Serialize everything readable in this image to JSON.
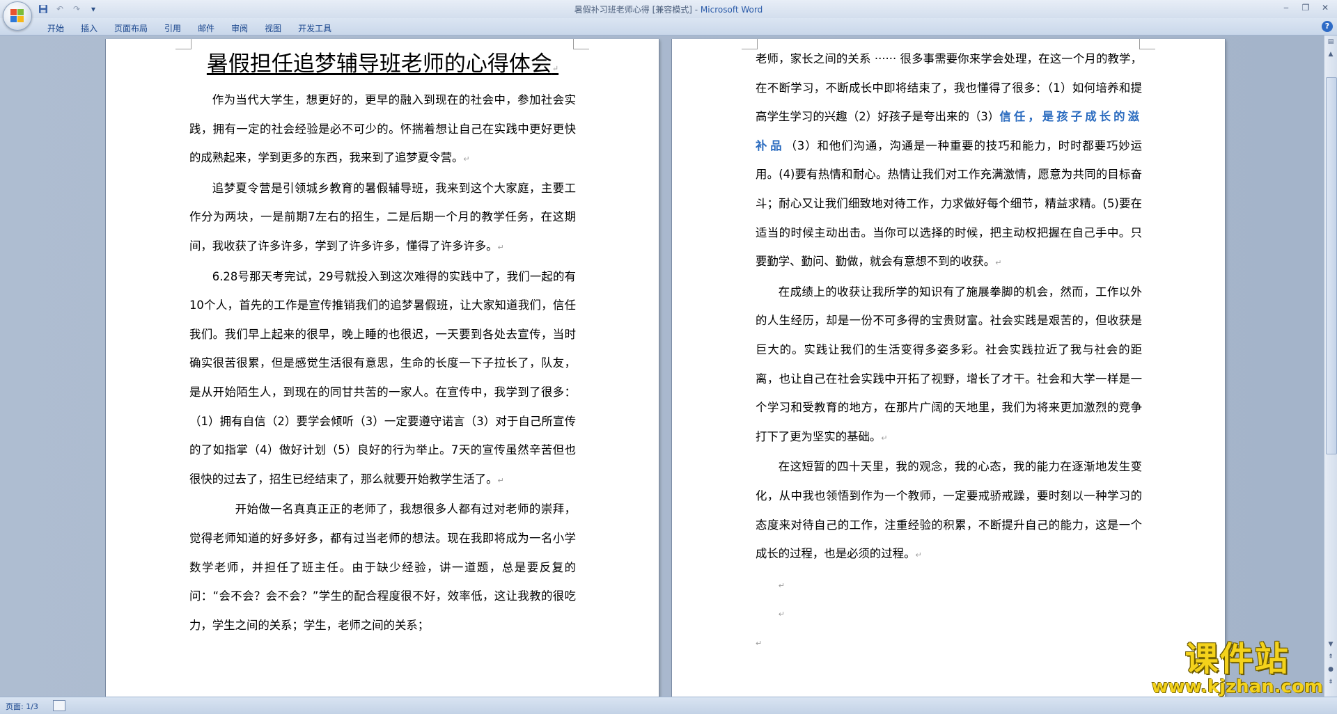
{
  "window": {
    "title_doc": "暑假补习班老师心得 [兼容模式] - ",
    "title_app": "Microsoft Word",
    "minimize": "‒",
    "maximize": "❐",
    "close": "✕"
  },
  "quick_access": {
    "icons": [
      "save-icon",
      "undo-icon",
      "redo-icon",
      "customize-qat-icon"
    ]
  },
  "ribbon": {
    "tabs": [
      "开始",
      "插入",
      "页面布局",
      "引用",
      "邮件",
      "审阅",
      "视图",
      "开发工具"
    ],
    "help": "?"
  },
  "document": {
    "title": "暑假担任追梦辅导班老师的心得体会",
    "left_page": [
      "作为当代大学生，想更好的，更早的融入到现在的社会中，参加社会实践，拥有一定的社会经验是必不可少的。怀揣着想让自己在实践中更好更快的成熟起来，学到更多的东西，我来到了追梦夏令营。",
      "追梦夏令营是引领城乡教育的暑假辅导班，我来到这个大家庭，主要工作分为两块，一是前期7左右的招生，二是后期一个月的教学任务，在这期间，我收获了许多许多，学到了许多许多，懂得了许多许多。",
      "6.28号那天考完试，29号就投入到这次难得的实践中了，我们一起的有10个人，首先的工作是宣传推销我们的追梦暑假班，让大家知道我们，信任我们。我们早上起来的很早，晚上睡的也很迟，一天要到各处去宣传，当时确实很苦很累，但是感觉生活很有意思，生命的长度一下子拉长了，队友，是从开始陌生人，到现在的同甘共苦的一家人。在宣传中，我学到了很多：（1）拥有自信（2）要学会倾听（3）一定要遵守诺言（3）对于自己所宣传的了如指掌（4）做好计划（5）良好的行为举止。7天的宣传虽然辛苦但也很快的过去了，招生已经结束了，那么就要开始教学生活了。",
      "开始做一名真真正正的老师了，我想很多人都有过对老师的崇拜，觉得老师知道的好多好多，都有过当老师的想法。现在我即将成为一名小学数学老师，并担任了班主任。由于缺少经验，讲一道题，总是要反复的问：“会不会？会不会？”学生的配合程度很不好，效率低，这让我教的很吃力，学生之间的关系；学生，老师之间的关系；"
    ],
    "right_page": {
      "p1_a": "老师，家长之间的关系 ······ 很多事需要你来学会处理，在这一个月的教学，在不断学习，不断成长中即将结束了，我也懂得了很多：（1）如何培养和提高学生学习的兴趣（2）好孩子是夸出来的（3）",
      "p1_blue": "信任，是孩子成长的滋补品",
      "p1_b": "（3）和他们沟通，沟通是一种重要的技巧和能力，时时都要巧妙运用。(4)要有热情和耐心。热情让我们对工作充满激情，愿意为共同的目标奋斗；耐心又让我们细致地对待工作，力求做好每个细节，精益求精。(5)要在适当的时候主动出击。当你可以选择的时候，把主动权把握在自己手中。只要勤学、勤问、勤做，就会有意想不到的收获。",
      "p2": "在成绩上的收获让我所学的知识有了施展拳脚的机会，然而，工作以外的人生经历，却是一份不可多得的宝贵财富。社会实践是艰苦的，但收获是巨大的。实践让我们的生活变得多姿多彩。社会实践拉近了我与社会的距离，也让自己在社会实践中开拓了视野，增长了才干。社会和大学一样是一个学习和受教育的地方，在那片广阔的天地里，我们为将来更加激烈的竞争打下了更为坚实的基础。",
      "p3": "在这短暂的四十天里，我的观念，我的心态，我的能力在逐渐地发生变化，从中我也领悟到作为一个教师，一定要戒骄戒躁，要时刻以一种学习的态度来对待自己的工作，注重经验的积累，不断提升自己的能力，这是一个成长的过程，也是必须的过程。"
    },
    "paragraph_mark": "↵"
  },
  "status_bar": {
    "page": "页面: 1/3"
  },
  "watermark": {
    "name": "课件站",
    "url": "www.kjzhan.com"
  },
  "colors": {
    "accent_blue": "#2a6bbf",
    "ribbon_text": "#15428b",
    "watermark_yellow": "#f4d21b"
  }
}
